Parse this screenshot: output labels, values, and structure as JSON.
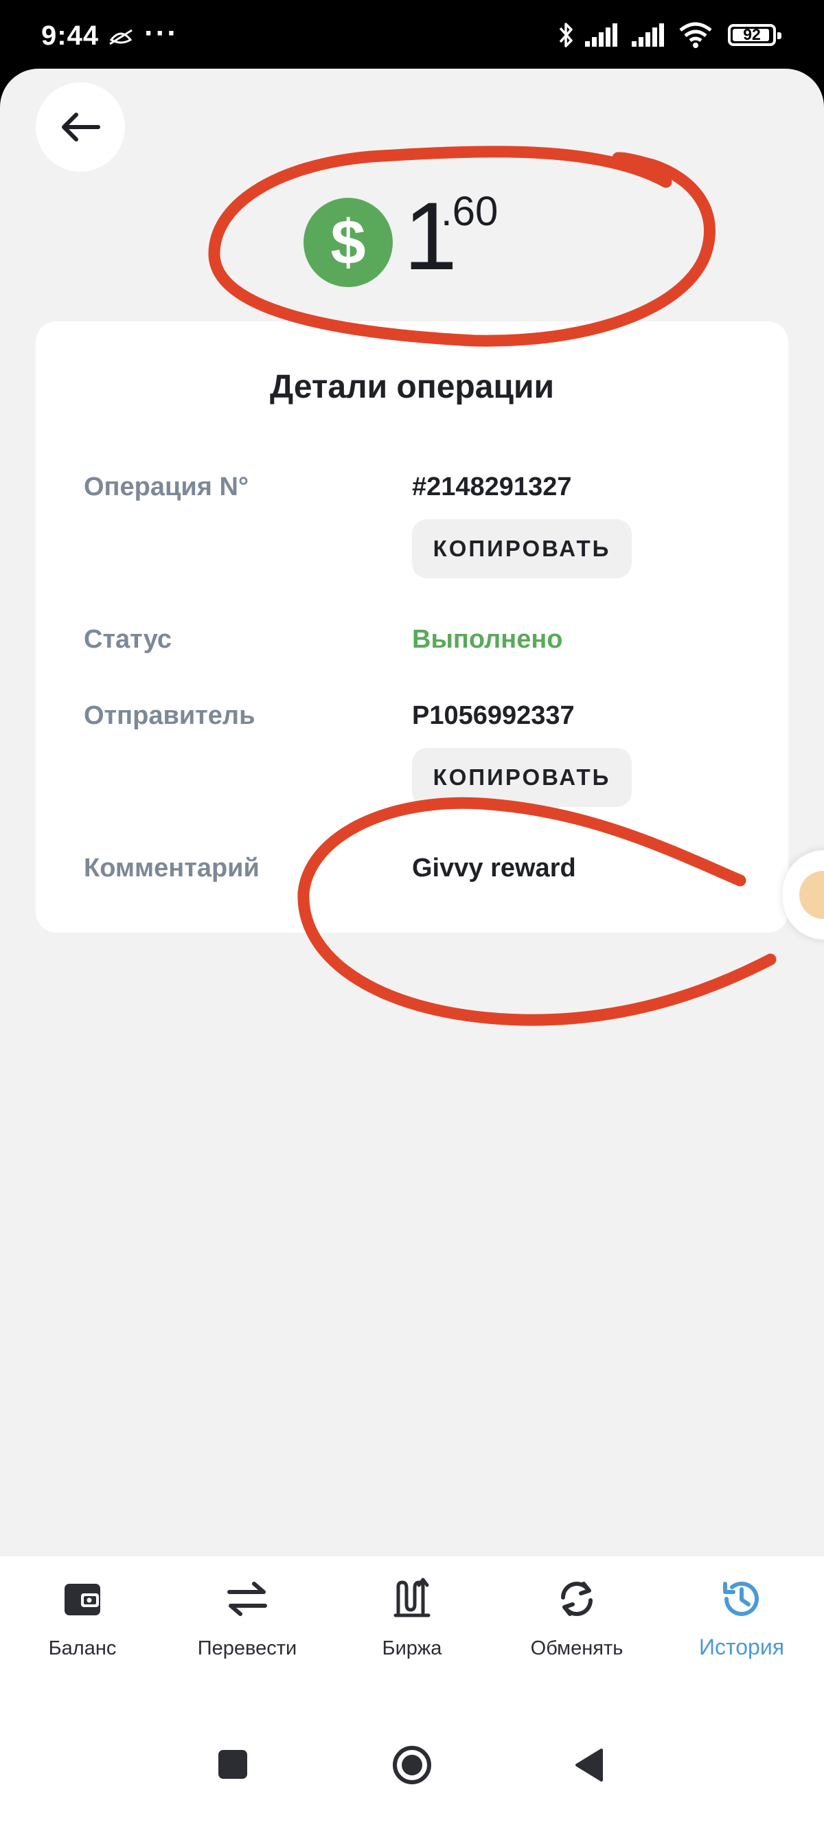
{
  "status_bar": {
    "time": "9:44",
    "dots": "···",
    "battery": "92"
  },
  "operation": {
    "currency_icon": "$",
    "amount_int": "1",
    "amount_dec": ".60"
  },
  "details": {
    "title": "Детали операции",
    "rows": [
      {
        "label": "Операция N°",
        "value": "#2148291327",
        "copy_label": "КОПИРОВАТЬ"
      },
      {
        "label": "Статус",
        "value": "Выполнено"
      },
      {
        "label": "Отправитель",
        "value": "P1056992337",
        "copy_label": "КОПИРОВАТЬ"
      },
      {
        "label": "Комментарий",
        "value": "Givvy reward"
      }
    ]
  },
  "colors": {
    "success": "#5aa95a",
    "accent": "#4a9ad8",
    "annotation": "#e04428",
    "muted_label": "#7d8897"
  },
  "nav": {
    "items": [
      {
        "label": "Баланс",
        "icon": "wallet-icon"
      },
      {
        "label": "Перевести",
        "icon": "transfer-arrows-icon"
      },
      {
        "label": "Биржа",
        "icon": "exchange-chart-icon"
      },
      {
        "label": "Обменять",
        "icon": "swap-refresh-icon"
      },
      {
        "label": "История",
        "icon": "history-clock-icon",
        "active": true
      }
    ]
  }
}
